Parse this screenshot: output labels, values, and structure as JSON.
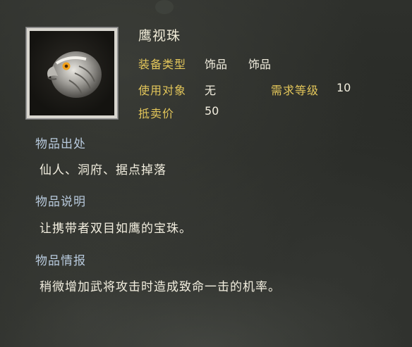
{
  "item": {
    "name": "鹰视珠",
    "icon": "hawk-orb-icon"
  },
  "stats": {
    "equip_type_label": "装备类型",
    "equip_type_value_1": "饰品",
    "equip_type_value_2": "饰品",
    "use_target_label": "使用对象",
    "use_target_value": "无",
    "required_level_label": "需求等级",
    "required_level_value": "10",
    "sell_price_label": "抵卖价",
    "sell_price_value": "50"
  },
  "sections": {
    "origin_title": "物品出处",
    "origin_text": "仙人、洞府、据点掉落",
    "desc_title": "物品说明",
    "desc_text": "让携带者双目如鹰的宝珠。",
    "intel_title": "物品情报",
    "intel_text": "稍微增加武将攻击时造成致命一击的机率。"
  },
  "colors": {
    "label_gold": "#e3c65a",
    "section_blue": "#b7c9dc",
    "value_white": "#f2eedf"
  }
}
